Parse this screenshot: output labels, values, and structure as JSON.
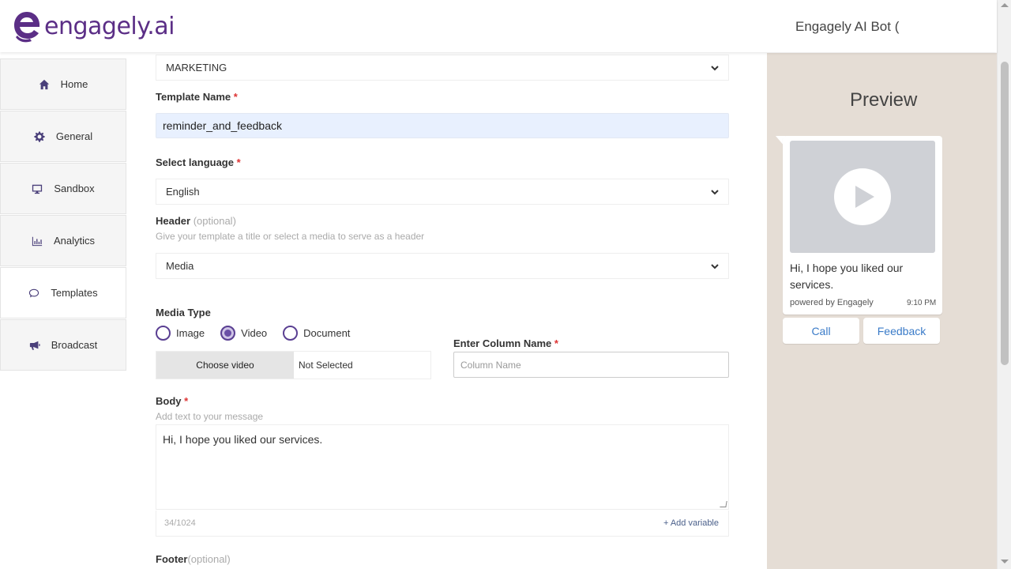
{
  "brand": {
    "name": "engagely.ai",
    "color": "#5b2e86"
  },
  "header": {
    "bot_name": "Engagely AI Bot ("
  },
  "sidebar": {
    "items": [
      {
        "label": "Home",
        "icon": "home-icon"
      },
      {
        "label": "General",
        "icon": "gear-icon"
      },
      {
        "label": "Sandbox",
        "icon": "monitor-icon"
      },
      {
        "label": "Analytics",
        "icon": "chart-icon"
      },
      {
        "label": "Templates",
        "icon": "chat-icon",
        "active": true
      },
      {
        "label": "Broadcast",
        "icon": "megaphone-icon"
      }
    ]
  },
  "form": {
    "category": {
      "value": "MARKETING"
    },
    "template_name": {
      "label": "Template Name",
      "required": "*",
      "value": "reminder_and_feedback"
    },
    "language": {
      "label": "Select language",
      "required": "*",
      "value": "English"
    },
    "header": {
      "label": "Header",
      "optional": "(optional)",
      "hint": "Give your template a title or select a media to serve as a header",
      "value": "Media"
    },
    "media_type": {
      "label": "Media Type",
      "options": [
        {
          "label": "Image",
          "checked": false
        },
        {
          "label": "Video",
          "checked": true
        },
        {
          "label": "Document",
          "checked": false
        }
      ]
    },
    "file": {
      "button_label": "Choose video",
      "status": "Not Selected"
    },
    "column_name": {
      "label": "Enter Column Name",
      "required": "*",
      "placeholder": "Column Name"
    },
    "body": {
      "label": "Body",
      "required": "*",
      "hint": "Add text to your message",
      "value": "Hi, I hope you liked our services.",
      "counter": "34/1024",
      "add_variable": "+ Add variable"
    },
    "footer": {
      "label": "Footer",
      "optional": "(optional)"
    }
  },
  "preview": {
    "title": "Preview",
    "message": "Hi, I hope you liked our services.",
    "powered_by": "powered by Engagely",
    "time": "9:10 PM",
    "buttons": [
      "Call",
      "Feedback"
    ]
  }
}
